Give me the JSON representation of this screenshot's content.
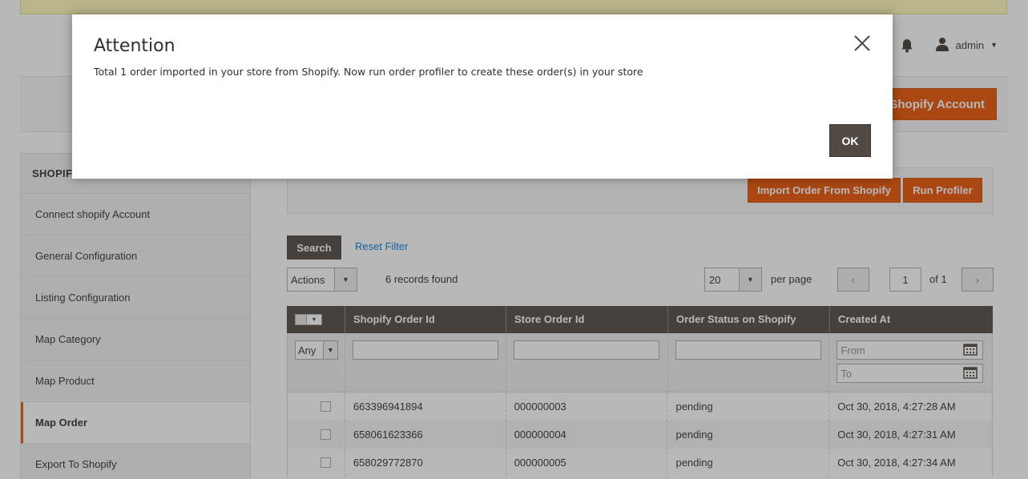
{
  "header": {
    "user_label": "admin",
    "account_button": "Shopify Account"
  },
  "sidebar": {
    "title": "SHOPIFY",
    "items": [
      {
        "label": "Connect shopify Account",
        "active": false
      },
      {
        "label": "General Configuration",
        "active": false
      },
      {
        "label": "Listing Configuration",
        "active": false
      },
      {
        "label": "Map Category",
        "active": false
      },
      {
        "label": "Map Product",
        "active": false
      },
      {
        "label": "Map Order",
        "active": true
      },
      {
        "label": "Export To Shopify",
        "active": false
      }
    ]
  },
  "actions": {
    "import_button": "Import Order From Shopify",
    "profiler_button": "Run Profiler"
  },
  "toolbar": {
    "search_button": "Search",
    "reset_filter": "Reset Filter",
    "actions_select": "Actions",
    "records_found": "6 records found",
    "per_page_value": "20",
    "per_page_label": "per page",
    "current_page": "1",
    "of_pages": "of 1"
  },
  "grid": {
    "columns": [
      "Shopify Order Id",
      "Store Order Id",
      "Order Status on Shopify",
      "Created At"
    ],
    "filters": {
      "any": "Any",
      "from_placeholder": "From",
      "to_placeholder": "To"
    },
    "rows": [
      {
        "shopify_id": "663396941894",
        "store_id": "000000003",
        "status": "pending",
        "created": "Oct 30, 2018, 4:27:28 AM"
      },
      {
        "shopify_id": "658061623366",
        "store_id": "000000004",
        "status": "pending",
        "created": "Oct 30, 2018, 4:27:31 AM"
      },
      {
        "shopify_id": "658029772870",
        "store_id": "000000005",
        "status": "pending",
        "created": "Oct 30, 2018, 4:27:34 AM"
      }
    ]
  },
  "modal": {
    "title": "Attention",
    "message": "Total 1 order imported in your store from Shopify. Now run order profiler to create these order(s) in your store",
    "ok_button": "OK"
  },
  "colors": {
    "accent": "#eb5202",
    "dark": "#514943",
    "link": "#007bdb"
  }
}
